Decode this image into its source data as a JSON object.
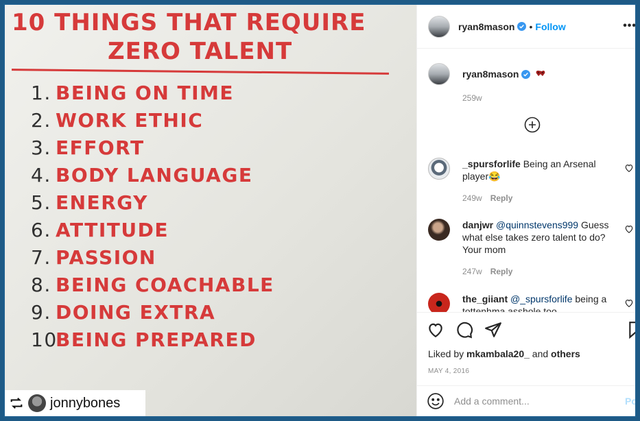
{
  "post_image": {
    "title_line1": "10 THINGS THAT REQUIRE",
    "title_line2": "ZERO TALENT",
    "items": [
      {
        "num": "1.",
        "text": "BEING ON TIME"
      },
      {
        "num": "2.",
        "text": "WORK ETHIC"
      },
      {
        "num": "3.",
        "text": "EFFORT"
      },
      {
        "num": "4.",
        "text": "BODY LANGUAGE"
      },
      {
        "num": "5.",
        "text": "ENERGY"
      },
      {
        "num": "6.",
        "text": "ATTITUDE"
      },
      {
        "num": "7.",
        "text": "PASSION"
      },
      {
        "num": "8.",
        "text": "BEING COACHABLE"
      },
      {
        "num": "9.",
        "text": "DOING EXTRA"
      },
      {
        "num": "10.",
        "text": "BEING PREPARED"
      }
    ],
    "repost_user": "jonnybones",
    "accent_color": "#d63a3a"
  },
  "header": {
    "username": "ryan8mason",
    "separator": "•",
    "follow_label": "Follow",
    "more_label": "•••"
  },
  "caption": {
    "username": "ryan8mason",
    "time": "259w"
  },
  "comments": [
    {
      "username": "_spursforlife",
      "text": "Being an Arsenal player😂",
      "time": "249w",
      "reply": "Reply"
    },
    {
      "username": "danjwr",
      "mention": "@quinnstevens999",
      "text": "Guess what else takes zero talent to do? Your mom",
      "time": "247w",
      "reply": "Reply"
    },
    {
      "username": "the_giiant",
      "mention": "@_spursforlife",
      "text": "being a tottenhma asshole too"
    }
  ],
  "actions": {
    "liked_by_prefix": "Liked by",
    "liked_by_user": "mkambala20_",
    "and_label": "and",
    "others_label": "others",
    "date": "MAY 4, 2016"
  },
  "add_comment": {
    "placeholder": "Add a comment...",
    "post_label": "Post"
  },
  "colors": {
    "link": "#0095f6",
    "frame": "#1f5f8e"
  }
}
